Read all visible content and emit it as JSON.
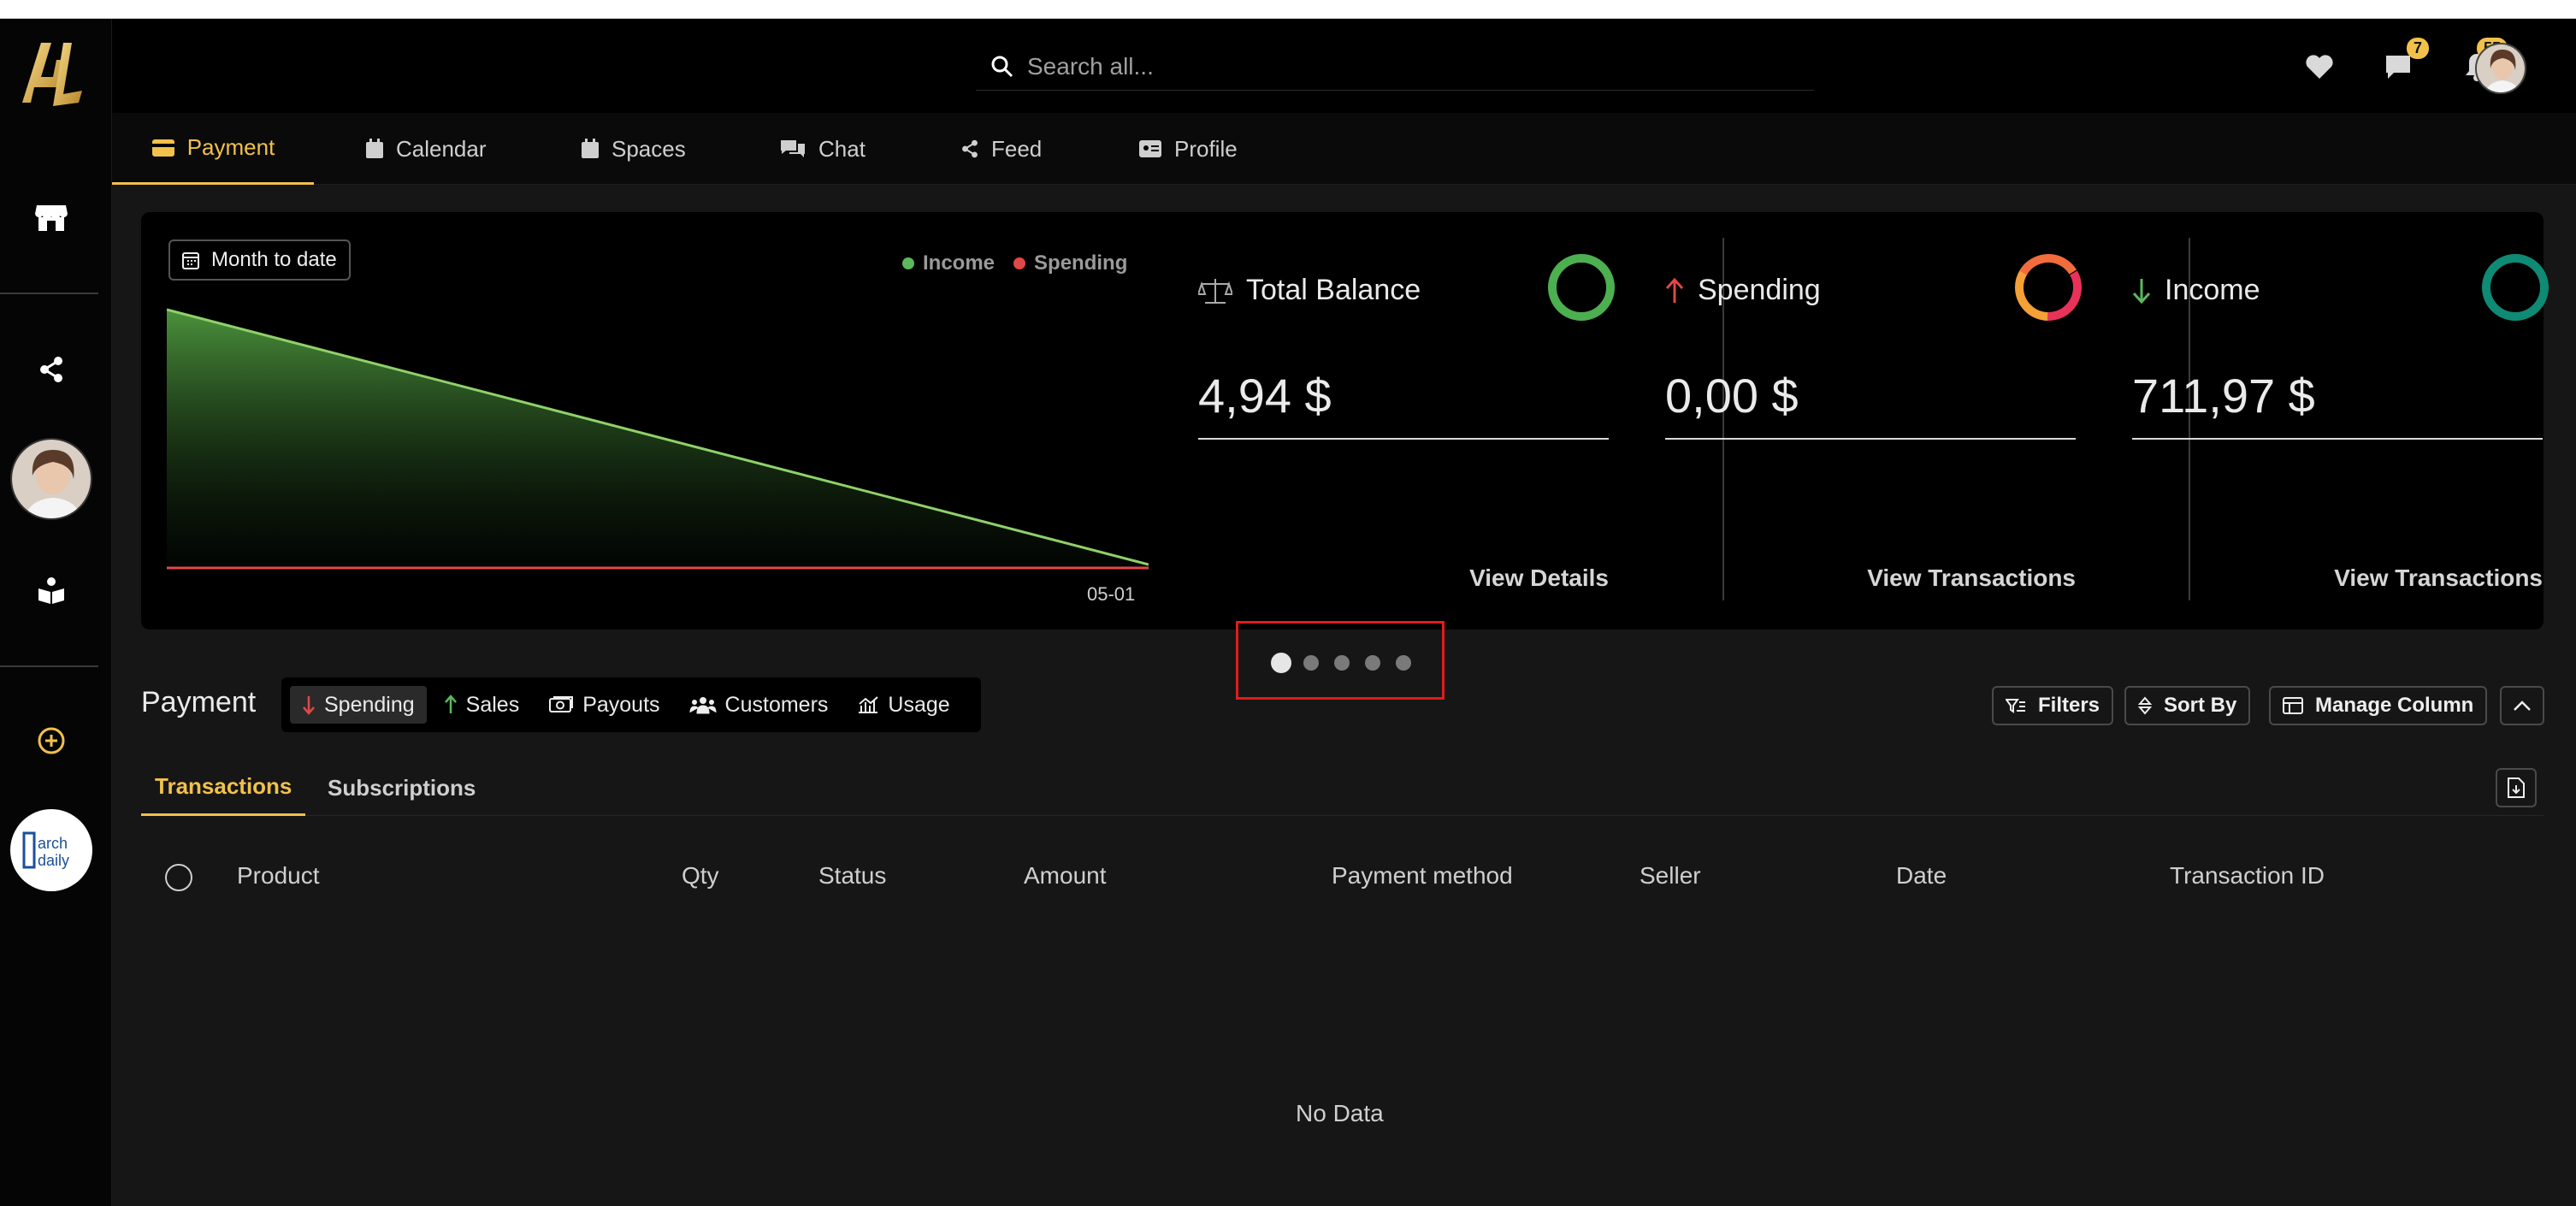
{
  "search": {
    "placeholder": "Search all..."
  },
  "header": {
    "messages_count": "7",
    "notifications_count": "55"
  },
  "tabs": [
    {
      "label": "Payment",
      "active": true
    },
    {
      "label": "Calendar"
    },
    {
      "label": "Spaces"
    },
    {
      "label": "Chat"
    },
    {
      "label": "Feed"
    },
    {
      "label": "Profile"
    }
  ],
  "overview": {
    "period_label": "Month to date",
    "legend": {
      "income": "Income",
      "spending": "Spending"
    },
    "chart_tick": "05-01",
    "stats": [
      {
        "title": "Total Balance",
        "amount": "4,94 $",
        "link": "View Details"
      },
      {
        "title": "Spending",
        "amount": "0,00 $",
        "link": "View Transactions"
      },
      {
        "title": "Income",
        "amount": "711,97 $",
        "link": "View Transactions"
      }
    ]
  },
  "payment": {
    "title": "Payment",
    "segments": [
      "Spending",
      "Sales",
      "Payouts",
      "Customers",
      "Usage"
    ],
    "filters_label": "Filters",
    "sort_label": "Sort By",
    "manage_column_label": "Manage Column",
    "subtabs": [
      "Transactions",
      "Subscriptions"
    ],
    "columns": [
      "Product",
      "Qty",
      "Status",
      "Amount",
      "Payment method",
      "Seller",
      "Date",
      "Transaction ID"
    ],
    "empty_text": "No Data"
  },
  "colors": {
    "accent": "#f2c14b",
    "income": "#5cb85c",
    "spending": "#e04848",
    "income_ring": "#0f8a74",
    "balance_ring": "#4caf50"
  }
}
